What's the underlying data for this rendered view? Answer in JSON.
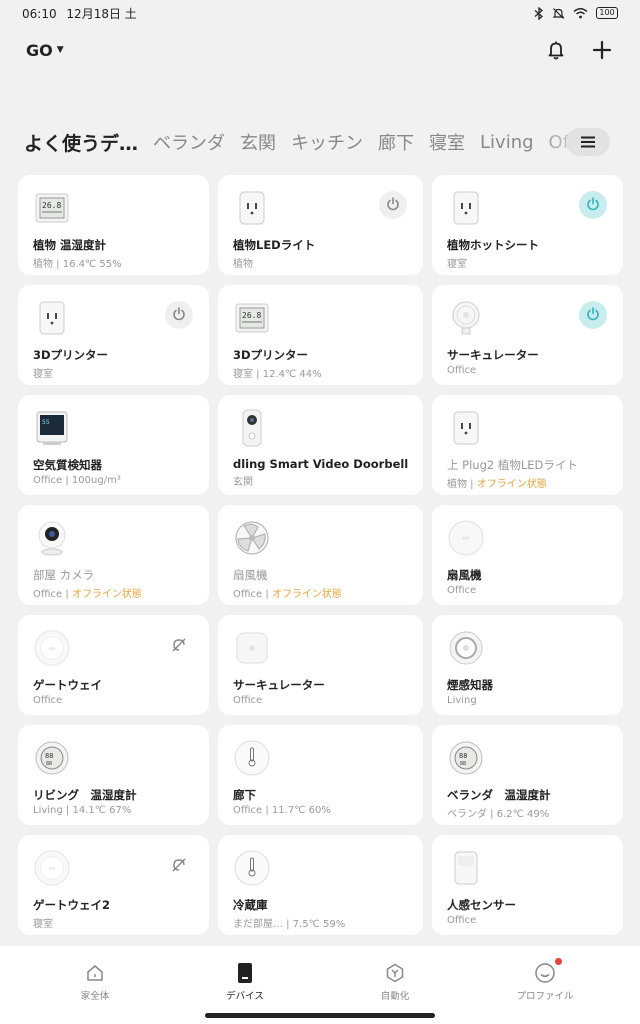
{
  "status_bar": {
    "time": "06:10",
    "date": "12月18日 土",
    "battery": "100"
  },
  "header": {
    "home_name": "GO"
  },
  "tabs": [
    {
      "label": "よく使うデ…",
      "active": true
    },
    {
      "label": "ベランダ",
      "active": false
    },
    {
      "label": "玄関",
      "active": false
    },
    {
      "label": "キッチン",
      "active": false
    },
    {
      "label": "廊下",
      "active": false
    },
    {
      "label": "寝室",
      "active": false
    },
    {
      "label": "Living",
      "active": false
    },
    {
      "label": "Office",
      "active": false
    }
  ],
  "devices": [
    {
      "name": "植物 温湿度計",
      "room": "植物",
      "status": " | 16.4℃ 55%",
      "icon": "thermo-display",
      "power": "none",
      "badge": "none",
      "offline": false
    },
    {
      "name": "植物LEDライト",
      "room": "植物",
      "status": "",
      "icon": "smart-plug",
      "power": "off",
      "badge": "none",
      "offline": false
    },
    {
      "name": "植物ホットシート",
      "room": "寝室",
      "status": "",
      "icon": "smart-plug",
      "power": "on",
      "badge": "none",
      "offline": false
    },
    {
      "name": "3Dプリンター",
      "room": "寝室",
      "status": "",
      "icon": "smart-plug",
      "power": "off",
      "badge": "none",
      "offline": false
    },
    {
      "name": "3Dプリンター",
      "room": "寝室",
      "status": " | 12.4℃ 44%",
      "icon": "thermo-display",
      "power": "none",
      "badge": "none",
      "offline": false
    },
    {
      "name": "サーキュレーター",
      "room": "Office",
      "status": "",
      "icon": "desk-fan",
      "power": "on",
      "badge": "none",
      "offline": false
    },
    {
      "name": "空気質検知器",
      "room": "Office",
      "status": " | 100ug/m³",
      "icon": "air-monitor",
      "power": "none",
      "badge": "none",
      "offline": false
    },
    {
      "name": "dling Smart Video Doorbell",
      "room": "玄関",
      "status": "",
      "icon": "doorbell",
      "power": "none",
      "badge": "none",
      "offline": false
    },
    {
      "name": "上 Plug2 植物LEDライト",
      "room": "植物",
      "status": "オフライン状態",
      "icon": "smart-plug",
      "power": "none",
      "badge": "none",
      "offline": true
    },
    {
      "name": "部屋 カメラ",
      "room": "Office",
      "status": "オフライン状態",
      "icon": "camera",
      "power": "none",
      "badge": "none",
      "offline": true
    },
    {
      "name": "扇風機",
      "room": "Office",
      "status": "オフライン状態",
      "icon": "fan-blades",
      "power": "none",
      "badge": "none",
      "offline": true
    },
    {
      "name": "扇風機",
      "room": "Office",
      "status": "",
      "icon": "round-device",
      "power": "none",
      "badge": "none",
      "offline": false
    },
    {
      "name": "ゲートウェイ",
      "room": "Office",
      "status": "",
      "icon": "gateway",
      "power": "none",
      "badge": "unlinked",
      "offline": false
    },
    {
      "name": "サーキュレーター",
      "room": "Office",
      "status": "",
      "icon": "square-device",
      "power": "none",
      "badge": "none",
      "offline": false
    },
    {
      "name": "煙感知器",
      "room": "Living",
      "status": "",
      "icon": "smoke-detector",
      "power": "none",
      "badge": "none",
      "offline": false
    },
    {
      "name": "リビング　温湿度計",
      "room": "Living",
      "status": " | 14.1℃ 67%",
      "icon": "round-thermo",
      "power": "none",
      "badge": "none",
      "offline": false
    },
    {
      "name": "廊下",
      "room": "Office",
      "status": " | 11.7℃ 60%",
      "icon": "thermometer-puck",
      "power": "none",
      "badge": "none",
      "offline": false
    },
    {
      "name": "ベランダ　温湿度計",
      "room": "ベランダ",
      "status": " | 6.2℃ 49%",
      "icon": "round-thermo",
      "power": "none",
      "badge": "none",
      "offline": false
    },
    {
      "name": "ゲートウェイ2",
      "room": "寝室",
      "status": "",
      "icon": "gateway",
      "power": "none",
      "badge": "unlinked",
      "offline": false
    },
    {
      "name": "冷蔵庫",
      "room": "まだ部屋…",
      "status": " | 7.5℃ 59%",
      "icon": "thermometer-puck",
      "power": "none",
      "badge": "none",
      "offline": false
    },
    {
      "name": "人感センサー",
      "room": "Office",
      "status": "",
      "icon": "motion-sensor",
      "power": "none",
      "badge": "none",
      "offline": false
    }
  ],
  "bottom_nav": [
    {
      "label": "家全体",
      "icon": "home-icon",
      "active": false,
      "dot": false
    },
    {
      "label": "デバイス",
      "icon": "device-icon",
      "active": true,
      "dot": false
    },
    {
      "label": "自動化",
      "icon": "automation-icon",
      "active": false,
      "dot": false
    },
    {
      "label": "プロファイル",
      "icon": "profile-icon",
      "active": false,
      "dot": true
    }
  ],
  "colors": {
    "background": "#f1f1f1",
    "card": "#ffffff",
    "power_on": "#c9ecee",
    "power_on_icon": "#2fb3bb",
    "offline_text": "#e6a23c",
    "notification_dot": "#e8413a"
  }
}
